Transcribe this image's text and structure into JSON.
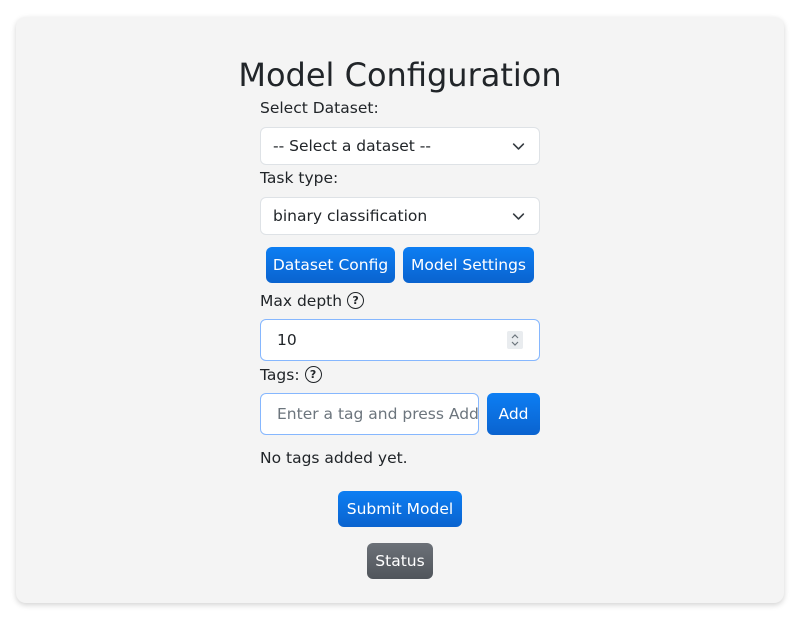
{
  "form": {
    "title": "Model Configuration",
    "dataset_label": "Select Dataset:",
    "dataset_selected": "-- Select a dataset --",
    "task_label": "Task type:",
    "task_selected": "binary classification",
    "dataset_config_button": "Dataset Config",
    "model_settings_button": "Model Settings",
    "max_depth_label": "Max depth",
    "max_depth_value": "10",
    "tags_label": "Tags:",
    "tag_placeholder": "Enter a tag and press Add",
    "add_button": "Add",
    "no_tags_text": "No tags added yet.",
    "submit_button": "Submit Model",
    "status_button": "Status",
    "help_glyph": "?"
  },
  "colors": {
    "primary": "#0b6fe0",
    "secondary": "#5c6167",
    "card_background": "#f4f4f4",
    "focus_border": "#86b7fe"
  },
  "icons": {
    "select_chevron": "chevron-down-icon",
    "help": "help-circle-icon",
    "spinner": "number-spinner-icon"
  }
}
